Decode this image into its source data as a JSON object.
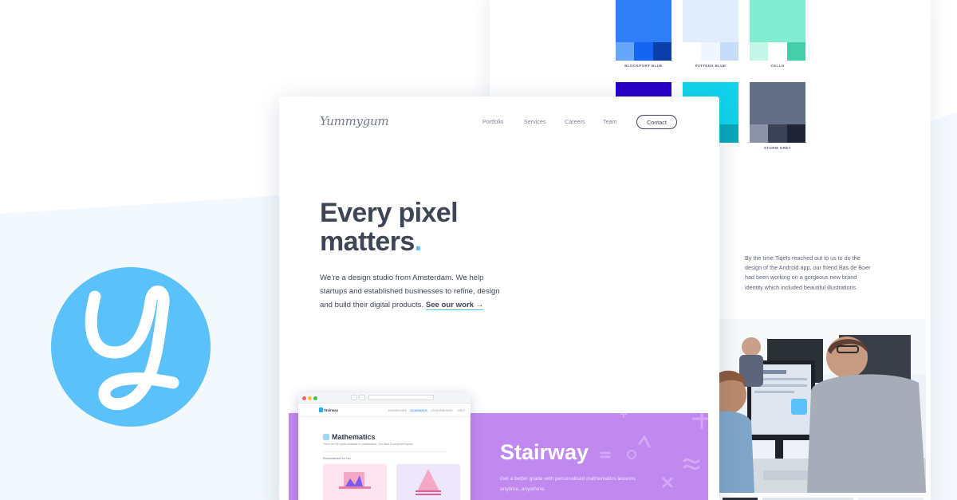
{
  "colors": {
    "accent": "#5ac1fb",
    "text": "#3e4655",
    "project_purple": "#c089f0"
  },
  "logo": {
    "icon": "yummygum-y-logo-icon"
  },
  "style_guide": {
    "swatches": [
      {
        "label": "BLOCKPORT BLUE",
        "main": "#2f7ef8",
        "shades": [
          "#66a6fb",
          "#1565f2",
          "#0c3ea8"
        ]
      },
      {
        "label": "PATTENS BLUE",
        "main": "#e1edfc",
        "shades": [
          "#ffffff",
          "#f0f6fe",
          "#c7dcf6"
        ]
      },
      {
        "label": "CELLO",
        "main": "#82edd1",
        "shades": [
          "#c5f7e9",
          "#ffffff",
          "#45cfa9"
        ]
      },
      {
        "label": "",
        "main": "#2a00c7",
        "shades": [
          "#4a21e0",
          "#2000a0",
          "#130075"
        ]
      },
      {
        "label": "",
        "main": "#12d3ec",
        "shades": [
          "#12c7df",
          "#12c7df",
          "#0aa6ba"
        ]
      },
      {
        "label": "STORM GREY",
        "main": "#646e87",
        "shades": [
          "#8a93a8",
          "#3b4256",
          "#1f2435"
        ]
      }
    ],
    "story": "By the time Tiqets reached out to us to do the design of the Android app, our friend Bas de Boer had been working on a gorgeous new brand identity which included beautiful illustrations."
  },
  "site": {
    "brand": "Yummygum",
    "nav": [
      "Portfolio",
      "Services",
      "Careers",
      "Team"
    ],
    "contact_label": "Contact",
    "headline_line1": "Every pixel",
    "headline_line2": "matters",
    "headline_dot": ".",
    "intro": "We’re a design studio from Amsterdam. We help startups and established businesses to refine, design and build their digital products.",
    "cta": "See our work →"
  },
  "project": {
    "title": "Stairway",
    "description": "Get a better grade with personalised mathematics lessons anytime, anywhere.",
    "app": {
      "logo": "Stairway",
      "tabs": [
        "DASHBOARD",
        "CLASSES ▾",
        "LEADERBOARD",
        "HELP"
      ],
      "heading": "Mathematics",
      "sub": "There are 26 topics available in mathematics. You have 3 completed topics.",
      "recommended": "Recommended for You"
    }
  }
}
